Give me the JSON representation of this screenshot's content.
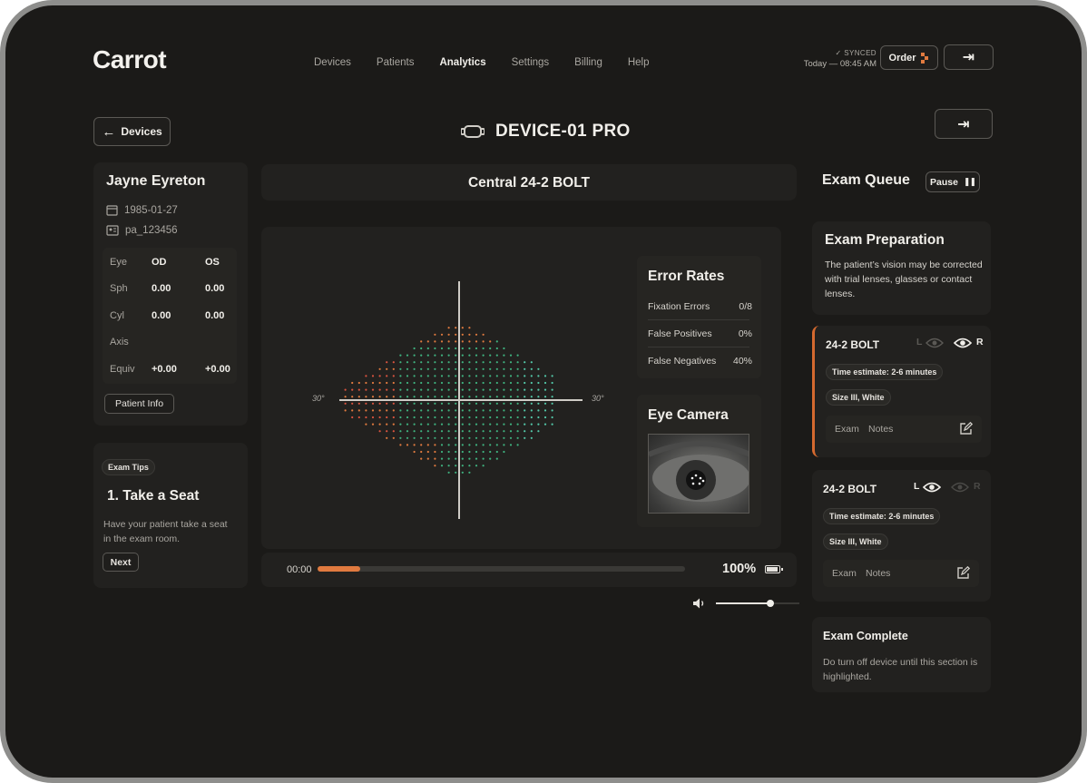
{
  "app": {
    "logo": "Carrot"
  },
  "nav": [
    {
      "label": "Devices"
    },
    {
      "label": "Patients"
    },
    {
      "label": "Analytics",
      "active": true
    },
    {
      "label": "Settings"
    },
    {
      "label": "Billing"
    },
    {
      "label": "Help"
    }
  ],
  "sync": {
    "status": "SYNCED",
    "time": "Today — 08:45 AM"
  },
  "header": {
    "order_label": "Order",
    "back_label": "Devices",
    "device_name": "DEVICE-01 PRO"
  },
  "patient": {
    "name": "Jayne Eyreton",
    "dob": "1985-01-27",
    "id": "pa_123456",
    "rx": [
      {
        "key": "Eye",
        "od": "OD",
        "os": "OS"
      },
      {
        "key": "Sph",
        "od": "0.00",
        "os": "0.00"
      },
      {
        "key": "Cyl",
        "od": "0.00",
        "os": "0.00"
      },
      {
        "key": "Axis",
        "od": "",
        "os": ""
      },
      {
        "key": "Equiv",
        "od": "+0.00",
        "os": "+0.00"
      }
    ],
    "info_button": "Patient Info"
  },
  "tips": {
    "tag": "Exam Tips",
    "title": "1. Take a Seat",
    "text": "Have your patient take a seat in the exam room.",
    "next": "Next"
  },
  "test": {
    "title": "Central 24-2 BOLT",
    "axis_left": "30°",
    "axis_right": "30°"
  },
  "error_rates": {
    "title": "Error Rates",
    "rows": [
      {
        "label": "Fixation Errors",
        "value": "0/8"
      },
      {
        "label": "False Positives",
        "value": "0%"
      },
      {
        "label": "False Negatives",
        "value": "40%"
      }
    ]
  },
  "camera": {
    "title": "Eye Camera"
  },
  "progress": {
    "time": "00:00",
    "fraction": 0.115,
    "battery": "100%",
    "battery_level": 1.0,
    "volume": 0.65
  },
  "queue": {
    "title": "Exam Queue",
    "pause": "Pause",
    "prep": {
      "title": "Exam Preparation",
      "text": "The patient’s vision may be corrected with trial lenses, glasses or contact lenses."
    },
    "exams": [
      {
        "name": "24-2 BOLT",
        "left": "L",
        "right": "R",
        "eye": "R",
        "time": "Time estimate: 2-6 minutes",
        "size": "Size III, White",
        "notes_a": "Exam",
        "notes_b": "Notes"
      },
      {
        "name": "24-2 BOLT",
        "left": "L",
        "right": "R",
        "eye": "L",
        "time": "Time estimate: 2-6 minutes",
        "size": "Size III, White",
        "notes_a": "Exam",
        "notes_b": "Notes"
      }
    ],
    "complete": {
      "title": "Exam Complete",
      "text": "Do turn off device until this section is highlighted."
    }
  },
  "colors": {
    "accent": "#e07a3f",
    "dot_red": "#d9533f",
    "dot_orange": "#e07a3f",
    "dot_green": "#3fb27f",
    "dot_teal": "#53c7a8"
  }
}
